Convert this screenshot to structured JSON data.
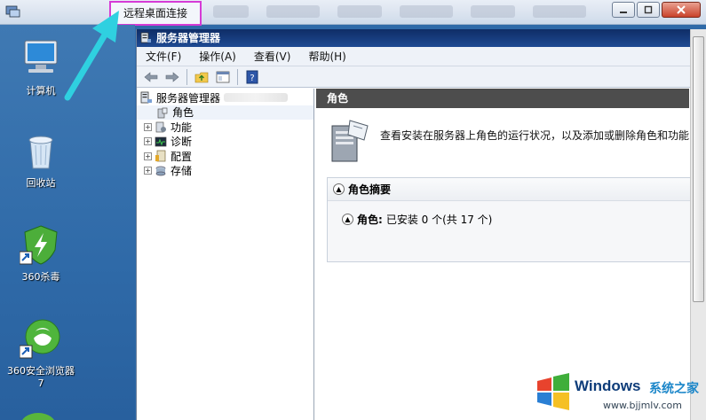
{
  "rdp": {
    "title": "远程桌面连接"
  },
  "desktop": {
    "icons": [
      {
        "label": "计算机"
      },
      {
        "label": "回收站"
      },
      {
        "label": "360杀毒"
      },
      {
        "label": "360安全浏览器7"
      }
    ]
  },
  "server_manager": {
    "title": "服务器管理器",
    "menu": [
      "文件(F)",
      "操作(A)",
      "查看(V)",
      "帮助(H)"
    ],
    "tree": {
      "root": "服务器管理器",
      "items": [
        "角色",
        "功能",
        "诊断",
        "配置",
        "存储"
      ]
    },
    "pane": {
      "header": "角色",
      "description": "查看安装在服务器上角色的运行状况，以及添加或删除角色和功能",
      "section_title": "角色摘要",
      "row_label": "角色:",
      "row_value": "已安装 0 个(共 17 个)"
    }
  },
  "watermark": {
    "brand": "Windows",
    "cn": "系统之家",
    "url": "www.bjjmlv.com"
  },
  "colors": {
    "title_highlight": "#d63bd6",
    "arrow": "#2fd0e0",
    "sm_titlebar": "#1e4a93",
    "pane_header": "#4d4d4d"
  }
}
